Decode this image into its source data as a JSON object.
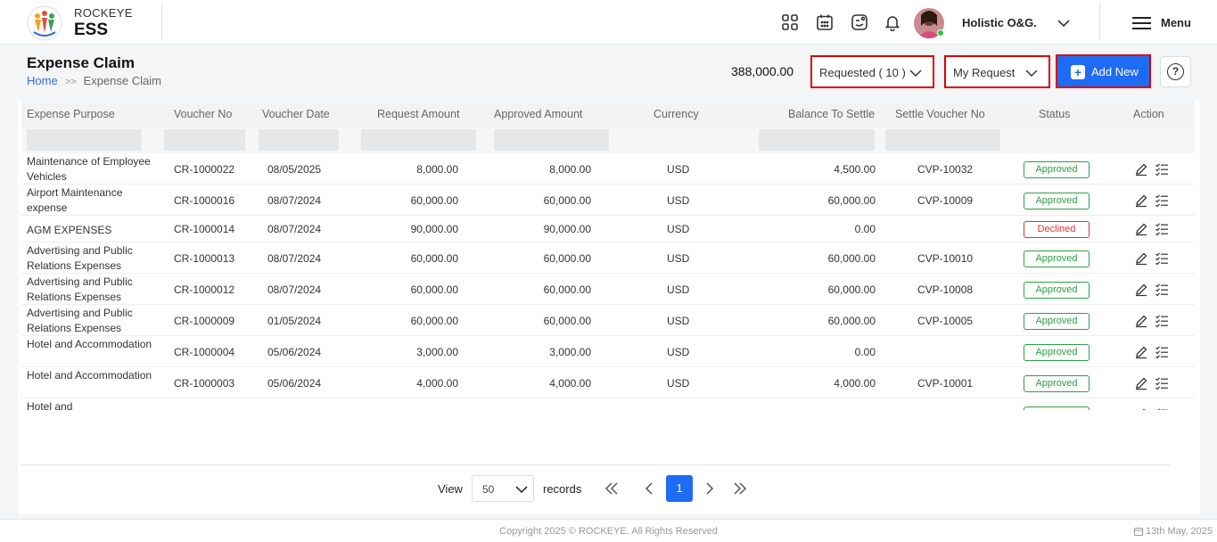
{
  "brand": {
    "line1": "ROCKEYE",
    "line2": "ESS"
  },
  "header": {
    "company": "Holistic O&G.",
    "menu_label": "Menu"
  },
  "page": {
    "title": "Expense Claim",
    "breadcrumb": {
      "home": "Home",
      "separator": ">>",
      "current": "Expense Claim"
    },
    "total": "388,000.00",
    "status_filter": "Requested ( 10 )",
    "scope_filter": "My Request",
    "add_new_label": "Add New",
    "help_label": "?"
  },
  "table": {
    "columns": [
      "Expense Purpose",
      "Voucher No",
      "Voucher Date",
      "Request Amount",
      "Approved Amount",
      "Currency",
      "Balance To Settle",
      "Settle Voucher No",
      "Status",
      "Action"
    ],
    "rows": [
      {
        "purpose": "Maintenance of Employee Vehicles",
        "voucher": "CR-1000022",
        "date": "08/05/2025",
        "request": "8,000.00",
        "approved": "8,000.00",
        "currency": "USD",
        "balance": "4,500.00",
        "settle": "CVP-10032",
        "status": "Approved"
      },
      {
        "purpose": "Airport Maintenance expense",
        "voucher": "CR-1000016",
        "date": "08/07/2024",
        "request": "60,000.00",
        "approved": "60,000.00",
        "currency": "USD",
        "balance": "60,000.00",
        "settle": "CVP-10009",
        "status": "Approved"
      },
      {
        "purpose": "AGM EXPENSES",
        "voucher": "CR-1000014",
        "date": "08/07/2024",
        "request": "90,000.00",
        "approved": "90,000.00",
        "currency": "USD",
        "balance": "0.00",
        "settle": "",
        "status": "Declined"
      },
      {
        "purpose": "Advertising and Public Relations Expenses",
        "voucher": "CR-1000013",
        "date": "08/07/2024",
        "request": "60,000.00",
        "approved": "60,000.00",
        "currency": "USD",
        "balance": "60,000.00",
        "settle": "CVP-10010",
        "status": "Approved"
      },
      {
        "purpose": "Advertising and Public Relations Expenses",
        "voucher": "CR-1000012",
        "date": "08/07/2024",
        "request": "60,000.00",
        "approved": "60,000.00",
        "currency": "USD",
        "balance": "60,000.00",
        "settle": "CVP-10008",
        "status": "Approved"
      },
      {
        "purpose": "Advertising and Public Relations Expenses",
        "voucher": "CR-1000009",
        "date": "01/05/2024",
        "request": "60,000.00",
        "approved": "60,000.00",
        "currency": "USD",
        "balance": "60,000.00",
        "settle": "CVP-10005",
        "status": "Approved"
      },
      {
        "purpose": "Hotel and Accommodation",
        "voucher": "CR-1000004",
        "date": "05/06/2024",
        "request": "3,000.00",
        "approved": "3,000.00",
        "currency": "USD",
        "balance": "0.00",
        "settle": "",
        "status": "Approved"
      },
      {
        "purpose": "Hotel and Accommodation",
        "voucher": "CR-1000003",
        "date": "05/06/2024",
        "request": "4,000.00",
        "approved": "4,000.00",
        "currency": "USD",
        "balance": "4,000.00",
        "settle": "CVP-10001",
        "status": "Approved"
      },
      {
        "purpose": "Hotel and",
        "voucher": "",
        "date": "",
        "request": "",
        "approved": "",
        "currency": "",
        "balance": "",
        "settle": "",
        "status": "Approved"
      }
    ]
  },
  "pagination": {
    "view_label": "View",
    "page_size": "50",
    "records_label": "records",
    "current_page": "1"
  },
  "footer": {
    "copyright": "Copyright 2025 © ROCKEYE. All Rights Reserved",
    "date": "13th May, 2025"
  },
  "colors": {
    "primary": "#1e6cf3",
    "highlight": "#e00000",
    "approved": "#2ea043",
    "declined": "#e0332f"
  }
}
